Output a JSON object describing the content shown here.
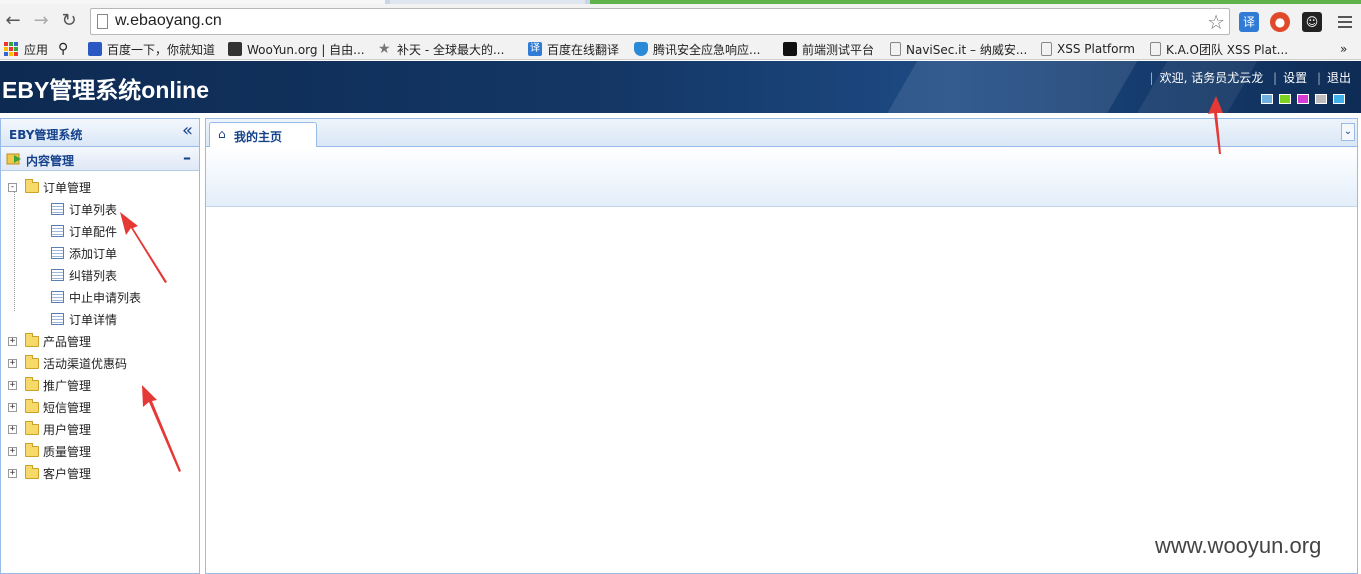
{
  "browser": {
    "url": "w.ebaoyang.cn",
    "bookmarks": [
      "应用",
      "百度一下，你就知道",
      "WooYun.org | 自由...",
      "补天 - 全球最大的...",
      "百度在线翻译",
      "腾讯安全应急响应...",
      "前端测试平台",
      "NaviSec.it – 纳威安...",
      "XSS Platform",
      "K.A.O团队 XSS Plat..."
    ],
    "overflow_label": "»"
  },
  "header": {
    "title": "EBY管理系统online",
    "welcome": "欢迎, 话务员尤云龙",
    "settings": "设置",
    "logout": "退出",
    "skin_colors": [
      "#6fb0e0",
      "#7ed321",
      "#d63fd6",
      "#bdbdbd",
      "#3fb0e8"
    ]
  },
  "sidebar": {
    "title": "EBY管理系统",
    "section": "内容管理",
    "tree": {
      "expanded": {
        "label": "订单管理",
        "children": [
          "订单列表",
          "订单配件",
          "添加订单",
          "纠错列表",
          "中止申请列表",
          "订单详情"
        ]
      },
      "collapsed": [
        "产品管理",
        "活动渠道优惠码",
        "推广管理",
        "短信管理",
        "用户管理",
        "质量管理",
        "客户管理"
      ]
    }
  },
  "main": {
    "tab_label": "我的主页"
  },
  "watermark": "www.wooyun.org"
}
